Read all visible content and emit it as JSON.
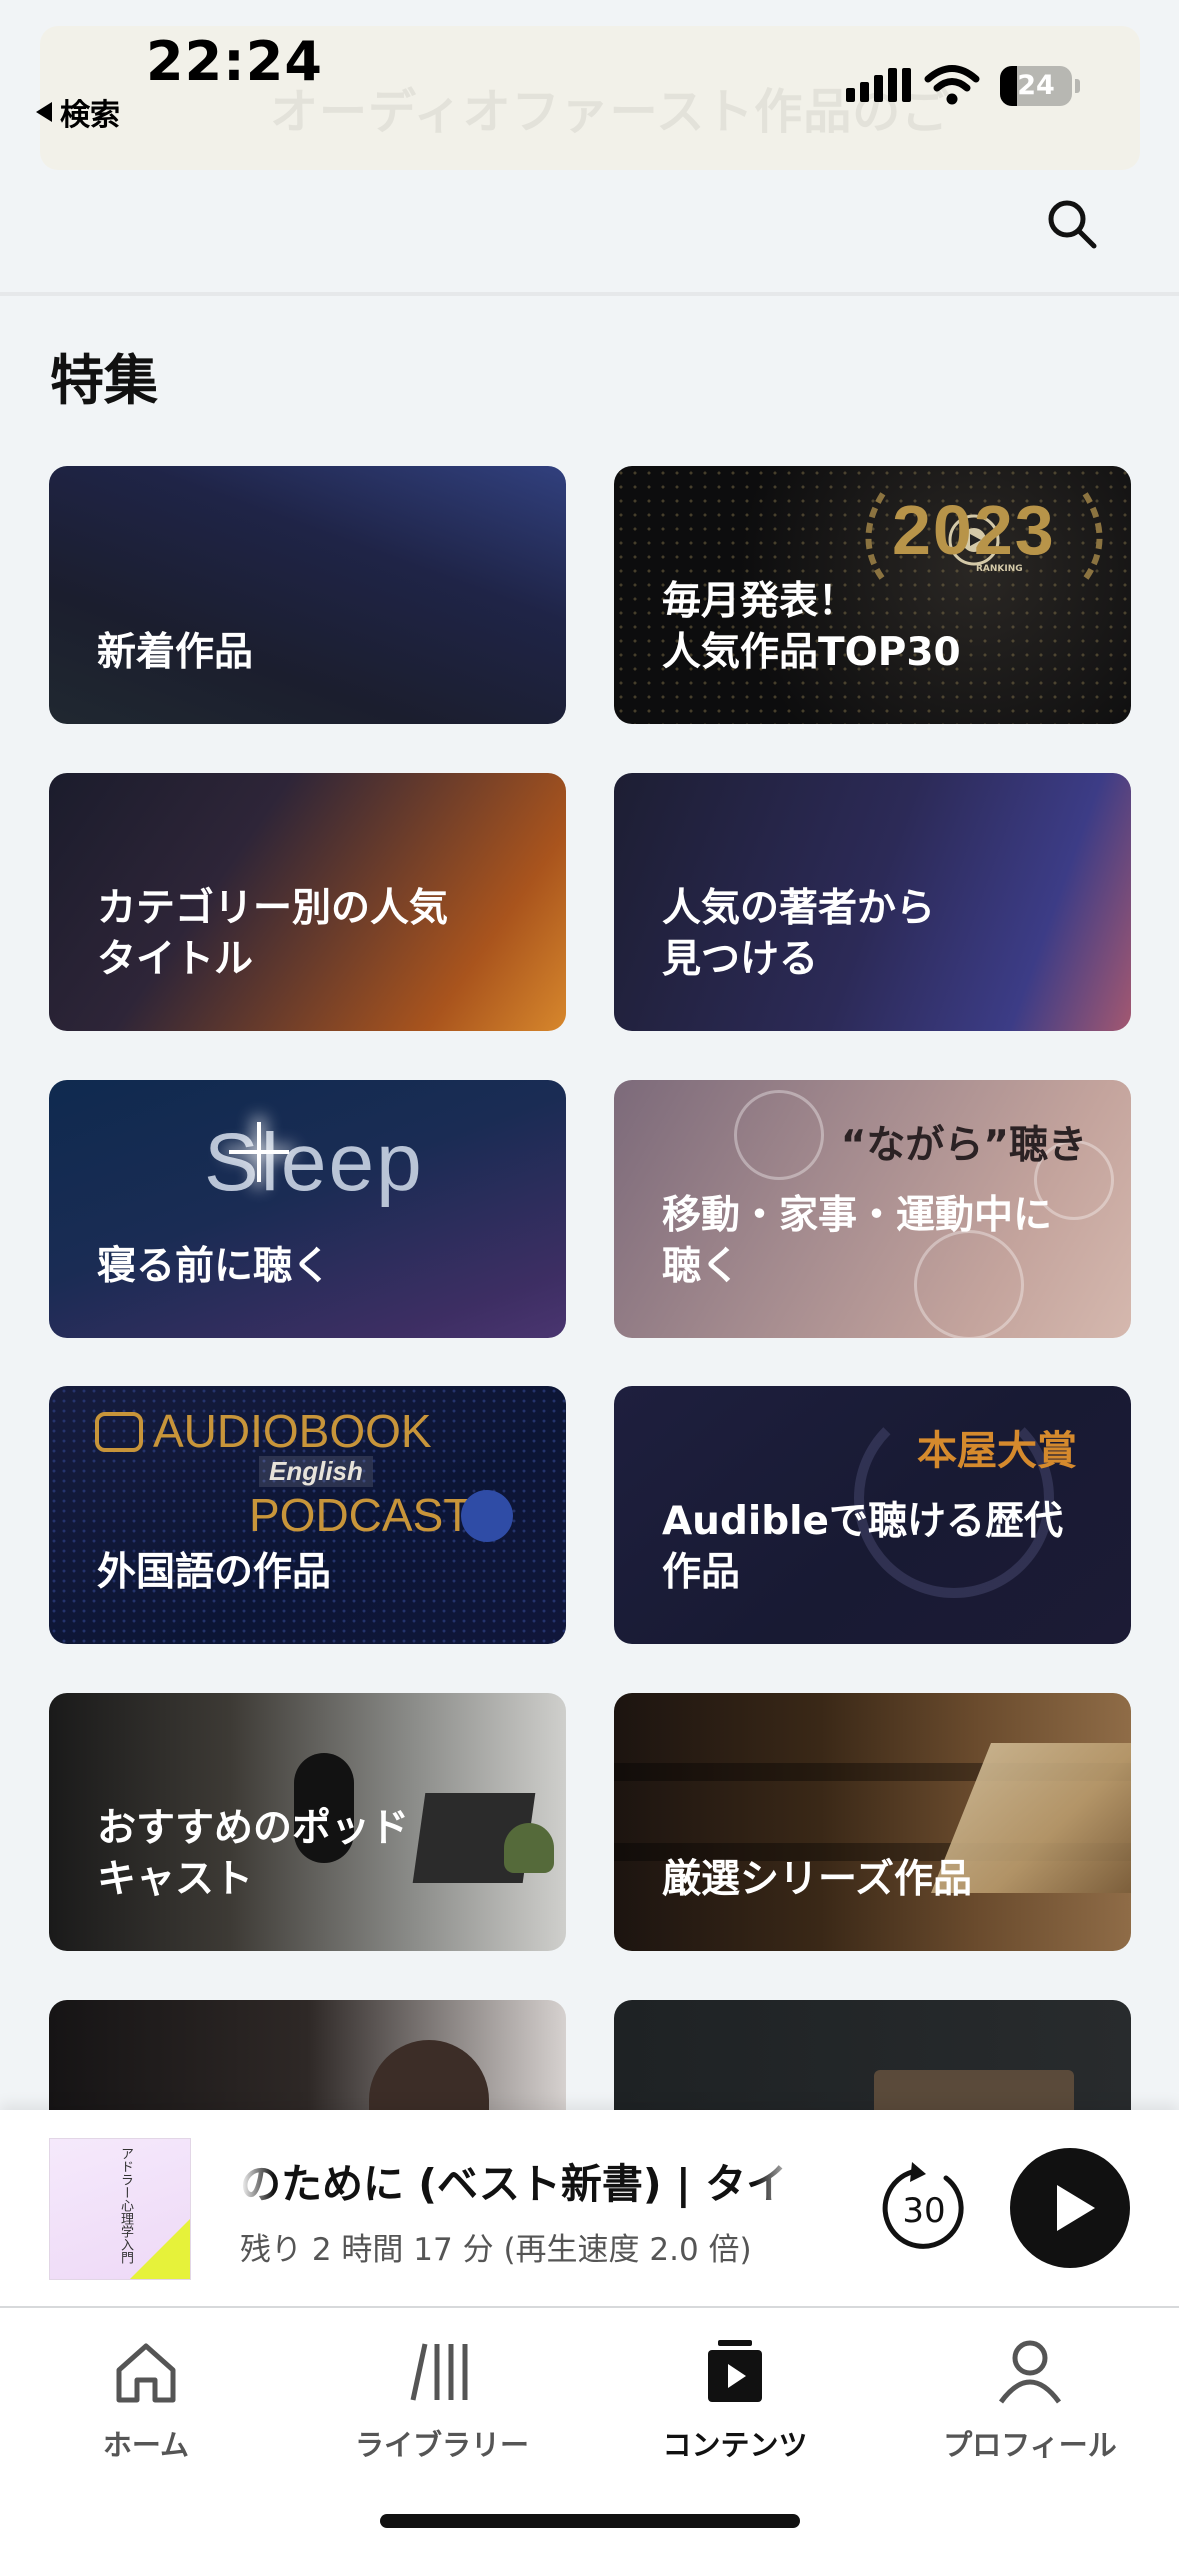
{
  "status_bar": {
    "time": "22:24",
    "back_label": "検索",
    "battery": "24",
    "battery_level": 0.24
  },
  "header": {
    "faded_title": "オーディオファースト作品のご",
    "search_icon": "search-icon"
  },
  "section": {
    "title": "特集"
  },
  "cards": [
    {
      "id": "new",
      "label": "新着作品"
    },
    {
      "id": "ranking",
      "label": "毎月発表！\n人気作品TOP30",
      "badge": "2023",
      "badge_sub": "RANKING"
    },
    {
      "id": "category",
      "label": "カテゴリー別の人気\nタイトル"
    },
    {
      "id": "author",
      "label": "人気の著者から\n見つける"
    },
    {
      "id": "sleep",
      "label": "寝る前に聴く",
      "image_word": "Sleep"
    },
    {
      "id": "nagara",
      "label": "移動・家事・運動中に\n聴く",
      "image_word": "“ながら”聴き"
    },
    {
      "id": "language",
      "label": "外国語の作品",
      "image_words": [
        "AUDIOBOOK",
        "English",
        "PODCAST"
      ]
    },
    {
      "id": "award",
      "label": "Audibleで聴ける歴代\n作品",
      "image_word": "本屋大賞"
    },
    {
      "id": "podcast",
      "label": "おすすめのポッド\nキャスト"
    },
    {
      "id": "series",
      "label": "厳選シリーズ作品"
    },
    {
      "id": "next1",
      "label": ""
    },
    {
      "id": "next2",
      "label": ""
    }
  ],
  "mini_player": {
    "title": "のために (ベスト新書) | タイト",
    "subtitle": "残り 2 時間 17 分 (再生速度 2.0 倍)",
    "skip_seconds": "30",
    "cover_text": "アドラー心理学入門"
  },
  "tabs": [
    {
      "label": "ホーム",
      "icon": "home-icon",
      "active": false
    },
    {
      "label": "ライブラリー",
      "icon": "library-icon",
      "active": false
    },
    {
      "label": "コンテンツ",
      "icon": "content-icon",
      "active": true
    },
    {
      "label": "プロフィール",
      "icon": "profile-icon",
      "active": false
    }
  ]
}
